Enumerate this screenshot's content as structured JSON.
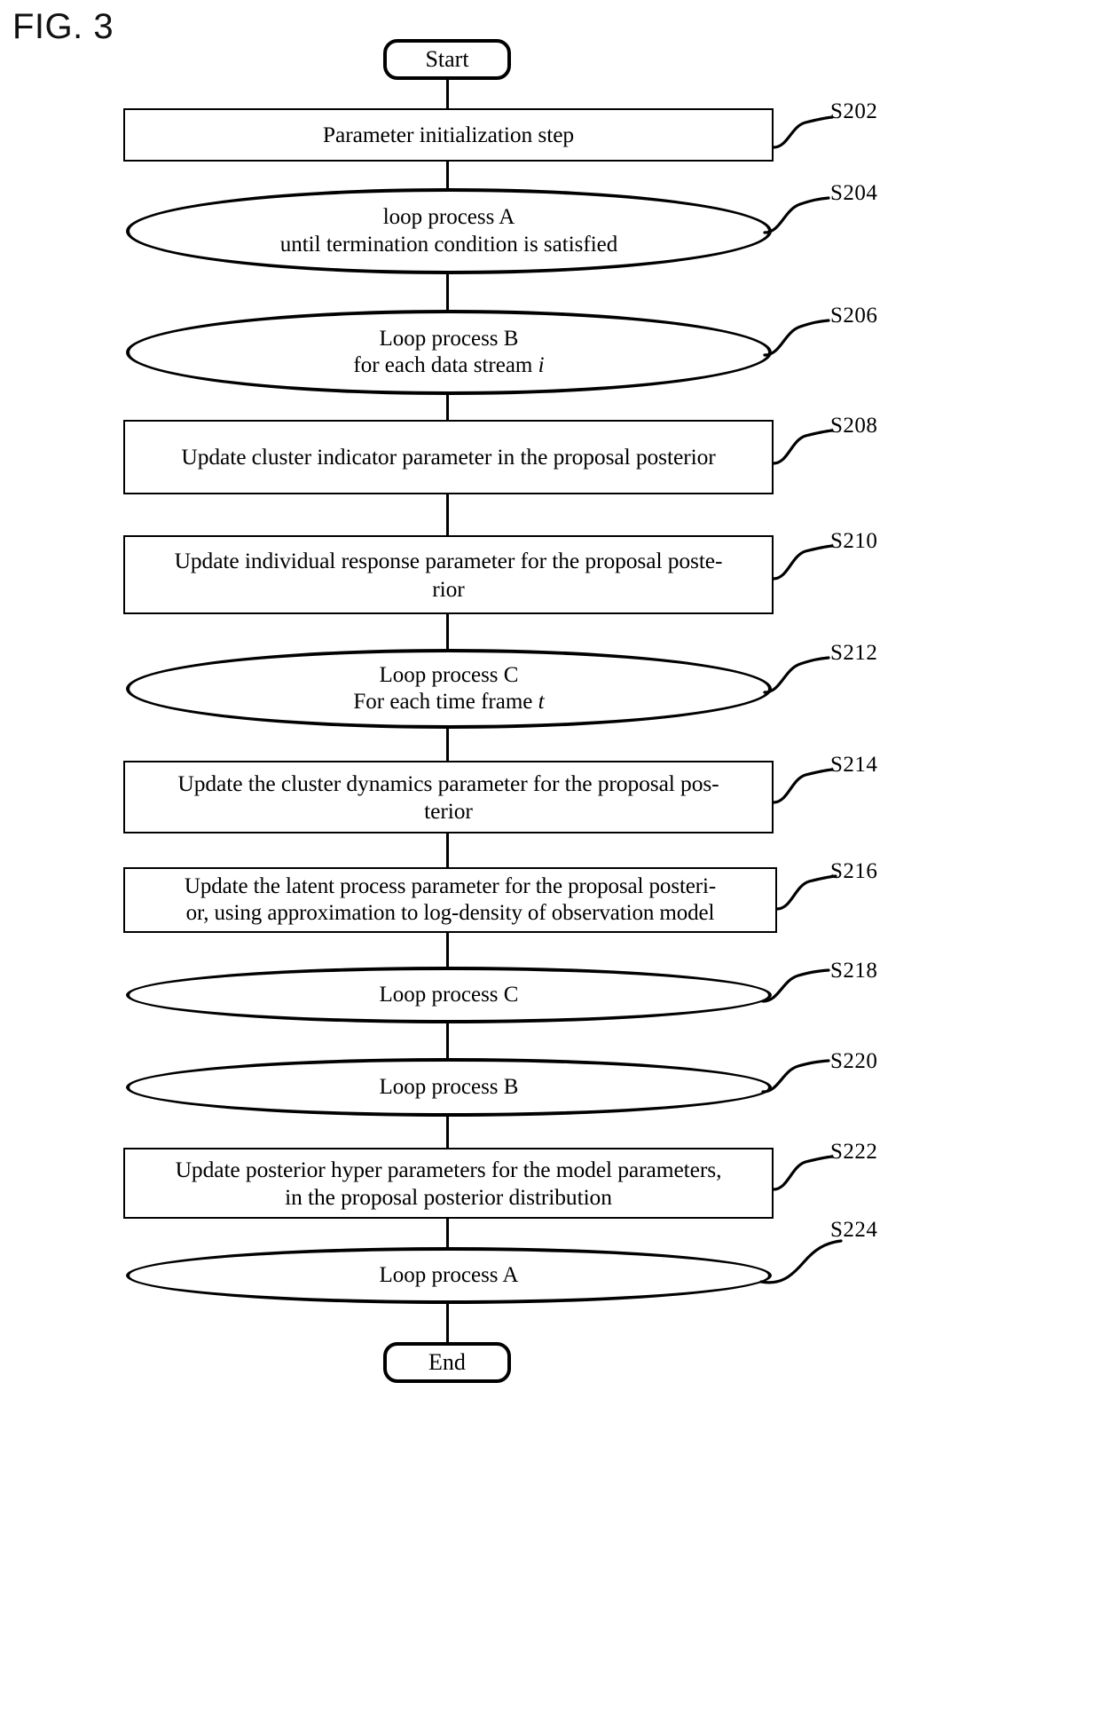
{
  "figure": {
    "label": "FIG. 3"
  },
  "flowchart": {
    "start": {
      "label": "Start"
    },
    "end": {
      "label": "End"
    },
    "nodes": [
      {
        "ref": "S202",
        "shape": "process",
        "text": "Parameter initialization step"
      },
      {
        "ref": "S204",
        "shape": "oval",
        "line1": "loop process A",
        "line2": "until termination condition is satisfied"
      },
      {
        "ref": "S206",
        "shape": "oval",
        "line1": "Loop process B",
        "line2_pre": "for each data stream ",
        "line2_var": "i"
      },
      {
        "ref": "S208",
        "shape": "process",
        "text": "Update cluster indicator parameter in the proposal posterior"
      },
      {
        "ref": "S210",
        "shape": "process",
        "line1": "Update individual response parameter for the proposal poste-",
        "line2": "rior"
      },
      {
        "ref": "S212",
        "shape": "oval",
        "line1": "Loop process C",
        "line2_pre": "For each time frame ",
        "line2_var": "t"
      },
      {
        "ref": "S214",
        "shape": "process",
        "line1": "Update the cluster dynamics parameter for the proposal pos-",
        "line2": "terior"
      },
      {
        "ref": "S216",
        "shape": "process",
        "line1": "Update the latent process parameter for the proposal posteri-",
        "line2": "or, using approximation to log-density of observation model"
      },
      {
        "ref": "S218",
        "shape": "pill",
        "line1": "Loop process C"
      },
      {
        "ref": "S220",
        "shape": "pill",
        "line1": "Loop process B"
      },
      {
        "ref": "S222",
        "shape": "process",
        "line1": "Update posterior hyper parameters for the model parameters,",
        "line2": "in the proposal posterior distribution"
      },
      {
        "ref": "S224",
        "shape": "pill",
        "line1": "Loop process A"
      }
    ]
  }
}
